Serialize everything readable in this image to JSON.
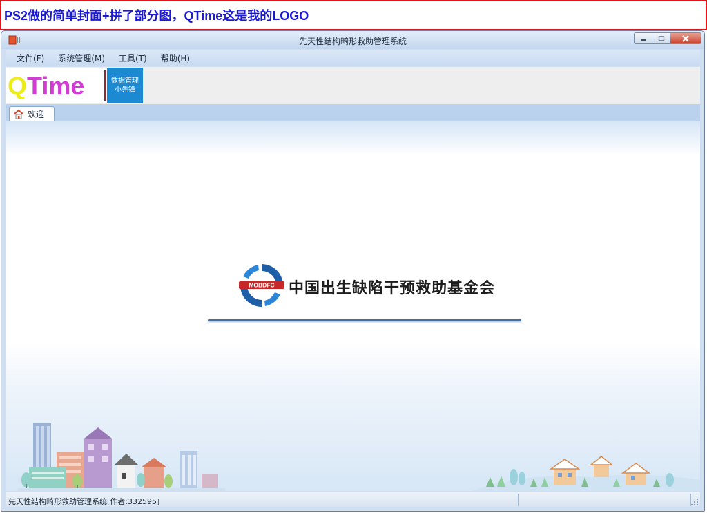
{
  "caption": "PS2做的简单封面+拼了部分图，QTime这是我的LOGO",
  "window": {
    "title": "先天性结构畸形救助管理系统",
    "minimize_icon": "minimize-icon",
    "maximize_icon": "maximize-icon",
    "close_icon": "close-icon"
  },
  "menu": {
    "items": [
      "文件(F)",
      "系统管理(M)",
      "工具(T)",
      "帮助(H)"
    ]
  },
  "toolbar": {
    "logo_q": "Q",
    "logo_rest": "Time",
    "logo_sub_line1": "数据管理",
    "logo_sub_line2": "小先锋"
  },
  "tabs": [
    {
      "label": "欢迎",
      "icon": "home-icon"
    }
  ],
  "welcome": {
    "emblem_text": "MOBDFC",
    "org_name": "中国出生缺陷干预救助基金会"
  },
  "statusbar": {
    "text": "先天性结构畸形救助管理系统[作者:332595]"
  },
  "colors": {
    "caption_text": "#1a19d6",
    "caption_border": "#e0141e",
    "logo_q": "#ecec1a",
    "logo_time": "#d43ad6",
    "logo_sub_bg": "#1b8ad3",
    "emblem_blue": "#1f5fa8",
    "underline": "#3f6fa3"
  }
}
